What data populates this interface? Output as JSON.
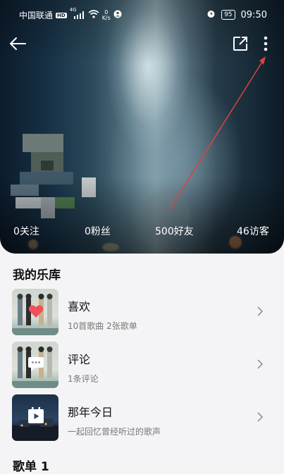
{
  "status_bar": {
    "carrier": "中国联通",
    "network_badge": "HD",
    "signal_text": "4G",
    "speed_value": "0",
    "speed_unit": "K/s",
    "battery": "95",
    "time": "09:50"
  },
  "toolbar": {
    "back_icon": "arrow-left-icon",
    "share_icon": "share-external-icon",
    "more_icon": "more-vertical-icon"
  },
  "stats": [
    {
      "label": "0关注"
    },
    {
      "label": "0粉丝"
    },
    {
      "label": "500好友"
    },
    {
      "label": "46访客"
    }
  ],
  "library": {
    "title": "我的乐库",
    "items": [
      {
        "title": "喜欢",
        "subtitle": "10首歌曲 2张歌单",
        "icon": "heart-icon"
      },
      {
        "title": "评论",
        "subtitle": "1条评论",
        "icon": "comment-icon"
      },
      {
        "title": "那年今日",
        "subtitle": "一起回忆曾经听过的歌声",
        "icon": "calendar-play-icon"
      }
    ]
  },
  "playlist_section": {
    "title": "歌单 1"
  },
  "colors": {
    "annotation_arrow": "#e0413a",
    "heart": "#f0505a",
    "background": "#f4f4f6"
  }
}
